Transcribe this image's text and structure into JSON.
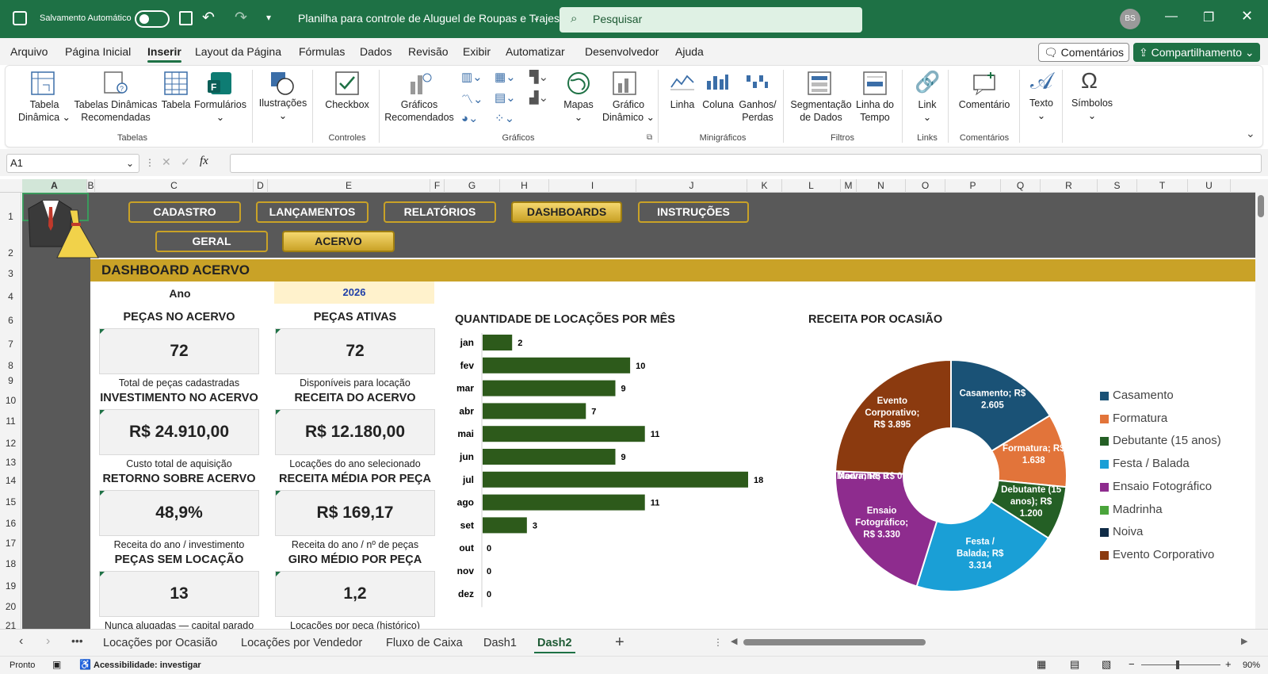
{
  "titlebar": {
    "autosave_label": "Salvamento Automático",
    "doc_title": "Planilha para controle de Aluguel de Roupas e Trajes",
    "search_placeholder": "Pesquisar",
    "user_initials": "BS"
  },
  "menu": {
    "items": [
      "Arquivo",
      "Página Inicial",
      "Inserir",
      "Layout da Página",
      "Fórmulas",
      "Dados",
      "Revisão",
      "Exibir",
      "Automatizar",
      "Desenvolvedor",
      "Ajuda"
    ],
    "active": "Inserir",
    "comments_label": "Comentários",
    "share_label": "Compartilhamento"
  },
  "ribbon": {
    "buttons": {
      "pivot": [
        "Tabela",
        "Dinâmica"
      ],
      "rec_pivot": [
        "Tabelas Dinâmicas",
        "Recomendadas"
      ],
      "table": "Tabela",
      "forms": "Formulários",
      "illustrations": "Ilustrações",
      "checkbox": "Checkbox",
      "rec_charts": [
        "Gráficos",
        "Recomendados"
      ],
      "maps": "Mapas",
      "pivot_chart": [
        "Gráfico",
        "Dinâmico"
      ],
      "line": "Linha",
      "column": "Coluna",
      "winloss": [
        "Ganhos/",
        "Perdas"
      ],
      "slicer": [
        "Segmentação",
        "de Dados"
      ],
      "timeline": [
        "Linha do",
        "Tempo"
      ],
      "link": "Link",
      "comment": "Comentário",
      "text": "Texto",
      "symbols": "Símbolos"
    },
    "groups": {
      "tables": "Tabelas",
      "controls": "Controles",
      "charts": "Gráficos",
      "sparklines": "Minigráficos",
      "filters": "Filtros",
      "links": "Links",
      "comments": "Comentários"
    }
  },
  "formula_bar": {
    "name_box": "A1",
    "fx": "fx",
    "content": ""
  },
  "columns": [
    "A",
    "B",
    "C",
    "D",
    "E",
    "F",
    "G",
    "H",
    "I",
    "J",
    "K",
    "L",
    "M",
    "N",
    "O",
    "P",
    "Q",
    "R",
    "S",
    "T",
    "U"
  ],
  "rows": [
    "1",
    "2",
    "3",
    "4",
    "6",
    "7",
    "8",
    "9",
    "10",
    "11",
    "12",
    "13",
    "14",
    "15",
    "16",
    "17",
    "18",
    "19",
    "20",
    "21"
  ],
  "nav": {
    "buttons": [
      "CADASTRO",
      "LANÇAMENTOS",
      "RELATÓRIOS",
      "DASHBOARDS",
      "INSTRUÇÕES"
    ],
    "active": "DASHBOARDS",
    "sub_buttons": [
      "GERAL",
      "ACERVO"
    ],
    "sub_active": "ACERVO"
  },
  "dashboard": {
    "title": "DASHBOARD ACERVO",
    "year_label": "Ano",
    "year_value": "2026",
    "kpis": [
      {
        "title": "PEÇAS NO ACERVO",
        "value": "72",
        "sub": "Total de peças cadastradas"
      },
      {
        "title": "PEÇAS ATIVAS",
        "value": "72",
        "sub": "Disponíveis para locação"
      },
      {
        "title": "INVESTIMENTO NO ACERVO",
        "value": "R$ 24.910,00",
        "sub": "Custo total de aquisição"
      },
      {
        "title": "RECEITA DO ACERVO",
        "value": "R$ 12.180,00",
        "sub": "Locações do ano selecionado"
      },
      {
        "title": "RETORNO SOBRE ACERVO",
        "value": "48,9%",
        "sub": "Receita do ano / investimento"
      },
      {
        "title": "RECEITA MÉDIA POR PEÇA",
        "value": "R$ 169,17",
        "sub": "Receita do ano / nº de peças"
      },
      {
        "title": "PEÇAS SEM LOCAÇÃO",
        "value": "13",
        "sub": "Nunca alugadas — capital parado"
      },
      {
        "title": "GIRO MÉDIO POR PEÇA",
        "value": "1,2",
        "sub": "Locações por peça (histórico)"
      }
    ]
  },
  "chart_data": [
    {
      "type": "bar",
      "orientation": "horizontal",
      "title": "QUANTIDADE DE LOCAÇÕES POR MÊS",
      "categories": [
        "jan",
        "fev",
        "mar",
        "abr",
        "mai",
        "jun",
        "jul",
        "ago",
        "set",
        "out",
        "nov",
        "dez"
      ],
      "values": [
        2,
        10,
        9,
        7,
        11,
        9,
        18,
        11,
        3,
        0,
        0,
        0
      ],
      "color": "#2d5a1b",
      "xlim": [
        0,
        18
      ],
      "grid": false
    },
    {
      "type": "pie",
      "donut": true,
      "title": "RECEITA POR OCASIÃO",
      "legend_position": "right",
      "slices": [
        {
          "name": "Casamento",
          "value": 2605,
          "label": "Casamento; R$ 2.605",
          "color": "#1a5276"
        },
        {
          "name": "Formatura",
          "value": 1638,
          "label": "Formatura; R$ 1.638",
          "color": "#e2743a"
        },
        {
          "name": "Debutante (15 anos)",
          "value": 1200,
          "label": "Debutante (15 anos); R$ 1.200",
          "color": "#245f25"
        },
        {
          "name": "Festa / Balada",
          "value": 3314,
          "label": "Festa / Balada; R$ 3.314",
          "color": "#1a9fd6"
        },
        {
          "name": "Ensaio Fotográfico",
          "value": 3330,
          "label": "Ensaio Fotográfico; R$ 3.330",
          "color": "#8e2c8e"
        },
        {
          "name": "Madrinha",
          "value": 0,
          "label": "Madrinha; R$ 0",
          "color": "#4aa43b"
        },
        {
          "name": "Noiva",
          "value": 0,
          "label": "Noiva; R$ 0",
          "color": "#0f2b46"
        },
        {
          "name": "Evento Corporativo",
          "value": 3895,
          "label": "Evento Corporativo; R$ 3.895",
          "color": "#8b3a0f"
        }
      ]
    }
  ],
  "sheet_tabs": [
    "Locações por Ocasião",
    "Locações por Vendedor",
    "Fluxo de Caixa",
    "Dash1",
    "Dash2"
  ],
  "active_tab": "Dash2",
  "status": {
    "ready": "Pronto",
    "accessibility": "Acessibilidade: investigar",
    "zoom": "90%"
  }
}
